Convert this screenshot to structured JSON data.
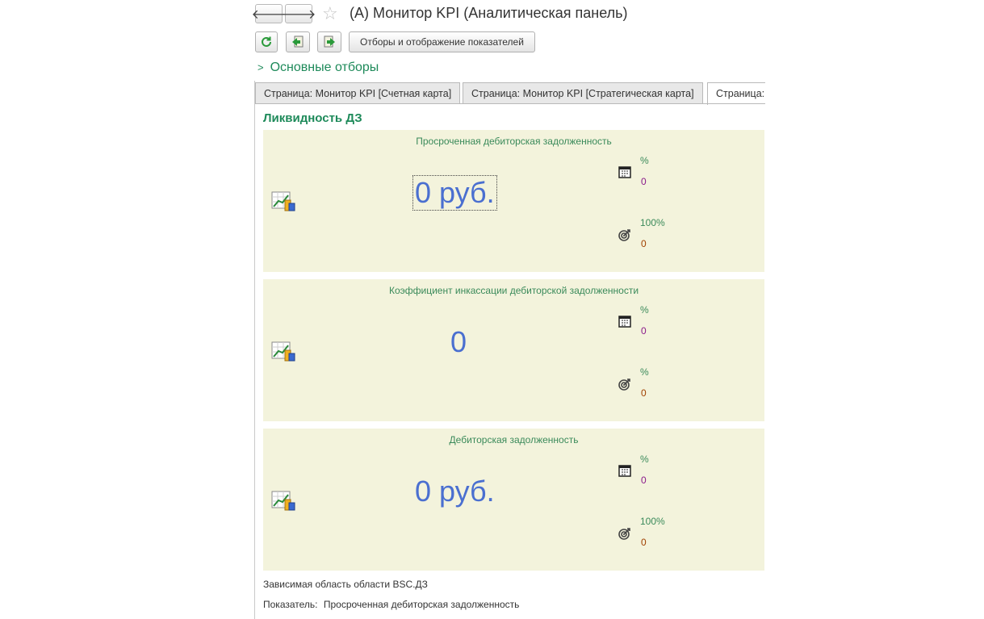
{
  "window": {
    "title": "(А) Монитор KPI (Аналитическая панель)"
  },
  "toolbar": {
    "filters_button_label": "Отборы и отображение показателей"
  },
  "filters_toggle": {
    "label": "Основные отборы"
  },
  "tabs": [
    {
      "label": "Страница: Монитор KPI [Счетная карта]",
      "active": false
    },
    {
      "label": "Страница: Монитор KPI [Стратегическая карта]",
      "active": false
    },
    {
      "label": "Страница:",
      "active": true
    }
  ],
  "section": {
    "title": "Ликвидность ДЗ"
  },
  "panels": [
    {
      "title": "Просроченная дебиторская задолженность",
      "value": "0 руб.",
      "period_pct": "%",
      "period_value": "0",
      "target_pct": "100%",
      "target_value": "0"
    },
    {
      "title": "Коэффициент инкассации дебиторской задолженности",
      "value": "0",
      "period_pct": "%",
      "period_value": "0",
      "target_pct": "%",
      "target_value": "0"
    },
    {
      "title": "Дебиторская задолженность",
      "value": "0 руб.",
      "period_pct": "%",
      "period_value": "0",
      "target_pct": "100%",
      "target_value": "0"
    }
  ],
  "footer": {
    "dependent_area": "Зависимая область области BSC.ДЗ",
    "indicator_label": "Показатель:",
    "indicator_value": "Просроченная дебиторская задолженность"
  },
  "colors": {
    "accent_green": "#1e8a5a",
    "panel_bg": "#f3f3dc",
    "value_blue": "#4a6fd0",
    "value_purple": "#8a1a8a",
    "value_brown": "#a04000"
  },
  "icons": [
    "back-arrow-icon",
    "forward-arrow-icon",
    "star-icon",
    "refresh-icon",
    "export-icon",
    "import-icon",
    "chevron-right-icon",
    "chart-icon",
    "calendar-icon",
    "target-icon"
  ]
}
